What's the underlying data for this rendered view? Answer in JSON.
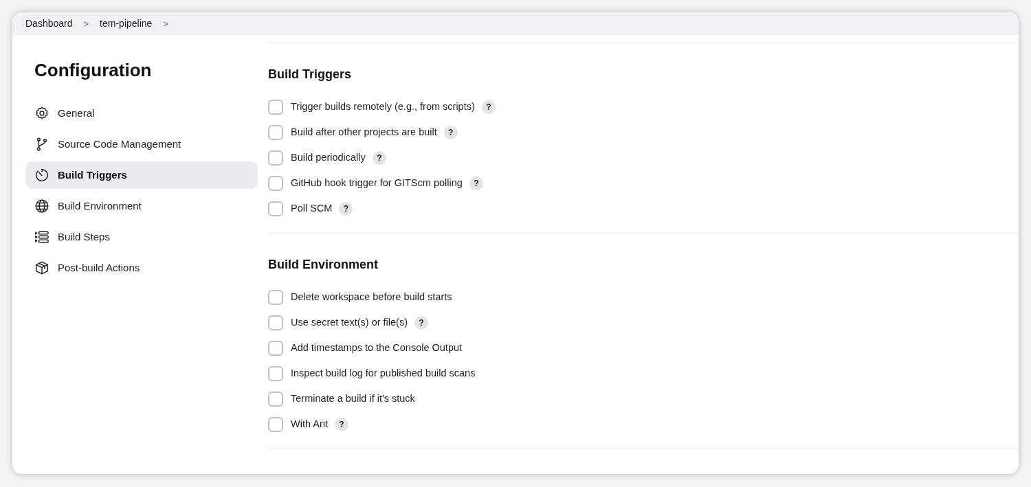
{
  "breadcrumb": [
    {
      "label": "Dashboard",
      "separator": ">"
    },
    {
      "label": "tem-pipeline",
      "separator": ">"
    }
  ],
  "sidebar": {
    "title": "Configuration",
    "items": [
      {
        "label": "General",
        "selected": false
      },
      {
        "label": "Source Code Management",
        "selected": false
      },
      {
        "label": "Build Triggers",
        "selected": true
      },
      {
        "label": "Build Environment",
        "selected": false
      },
      {
        "label": "Build Steps",
        "selected": false
      },
      {
        "label": "Post-build Actions",
        "selected": false
      }
    ]
  },
  "sections": [
    {
      "title": "Build Triggers",
      "options": [
        {
          "label": "Trigger builds remotely (e.g., from scripts)",
          "checked": false,
          "help": "?"
        },
        {
          "label": "Build after other projects are built",
          "checked": false,
          "help": "?"
        },
        {
          "label": "Build periodically",
          "checked": false,
          "help": "?"
        },
        {
          "label": "GitHub hook trigger for GITScm polling",
          "checked": false,
          "help": "?"
        },
        {
          "label": "Poll SCM",
          "checked": false,
          "help": "?"
        }
      ]
    },
    {
      "title": "Build Environment",
      "options": [
        {
          "label": "Delete workspace before build starts",
          "checked": false
        },
        {
          "label": "Use secret text(s) or file(s)",
          "checked": false,
          "help": "?"
        },
        {
          "label": "Add timestamps to the Console Output",
          "checked": false
        },
        {
          "label": "Inspect build log for published build scans",
          "checked": false
        },
        {
          "label": "Terminate a build if it's stuck",
          "checked": false
        },
        {
          "label": "With Ant",
          "checked": false,
          "help": "?"
        }
      ]
    }
  ]
}
